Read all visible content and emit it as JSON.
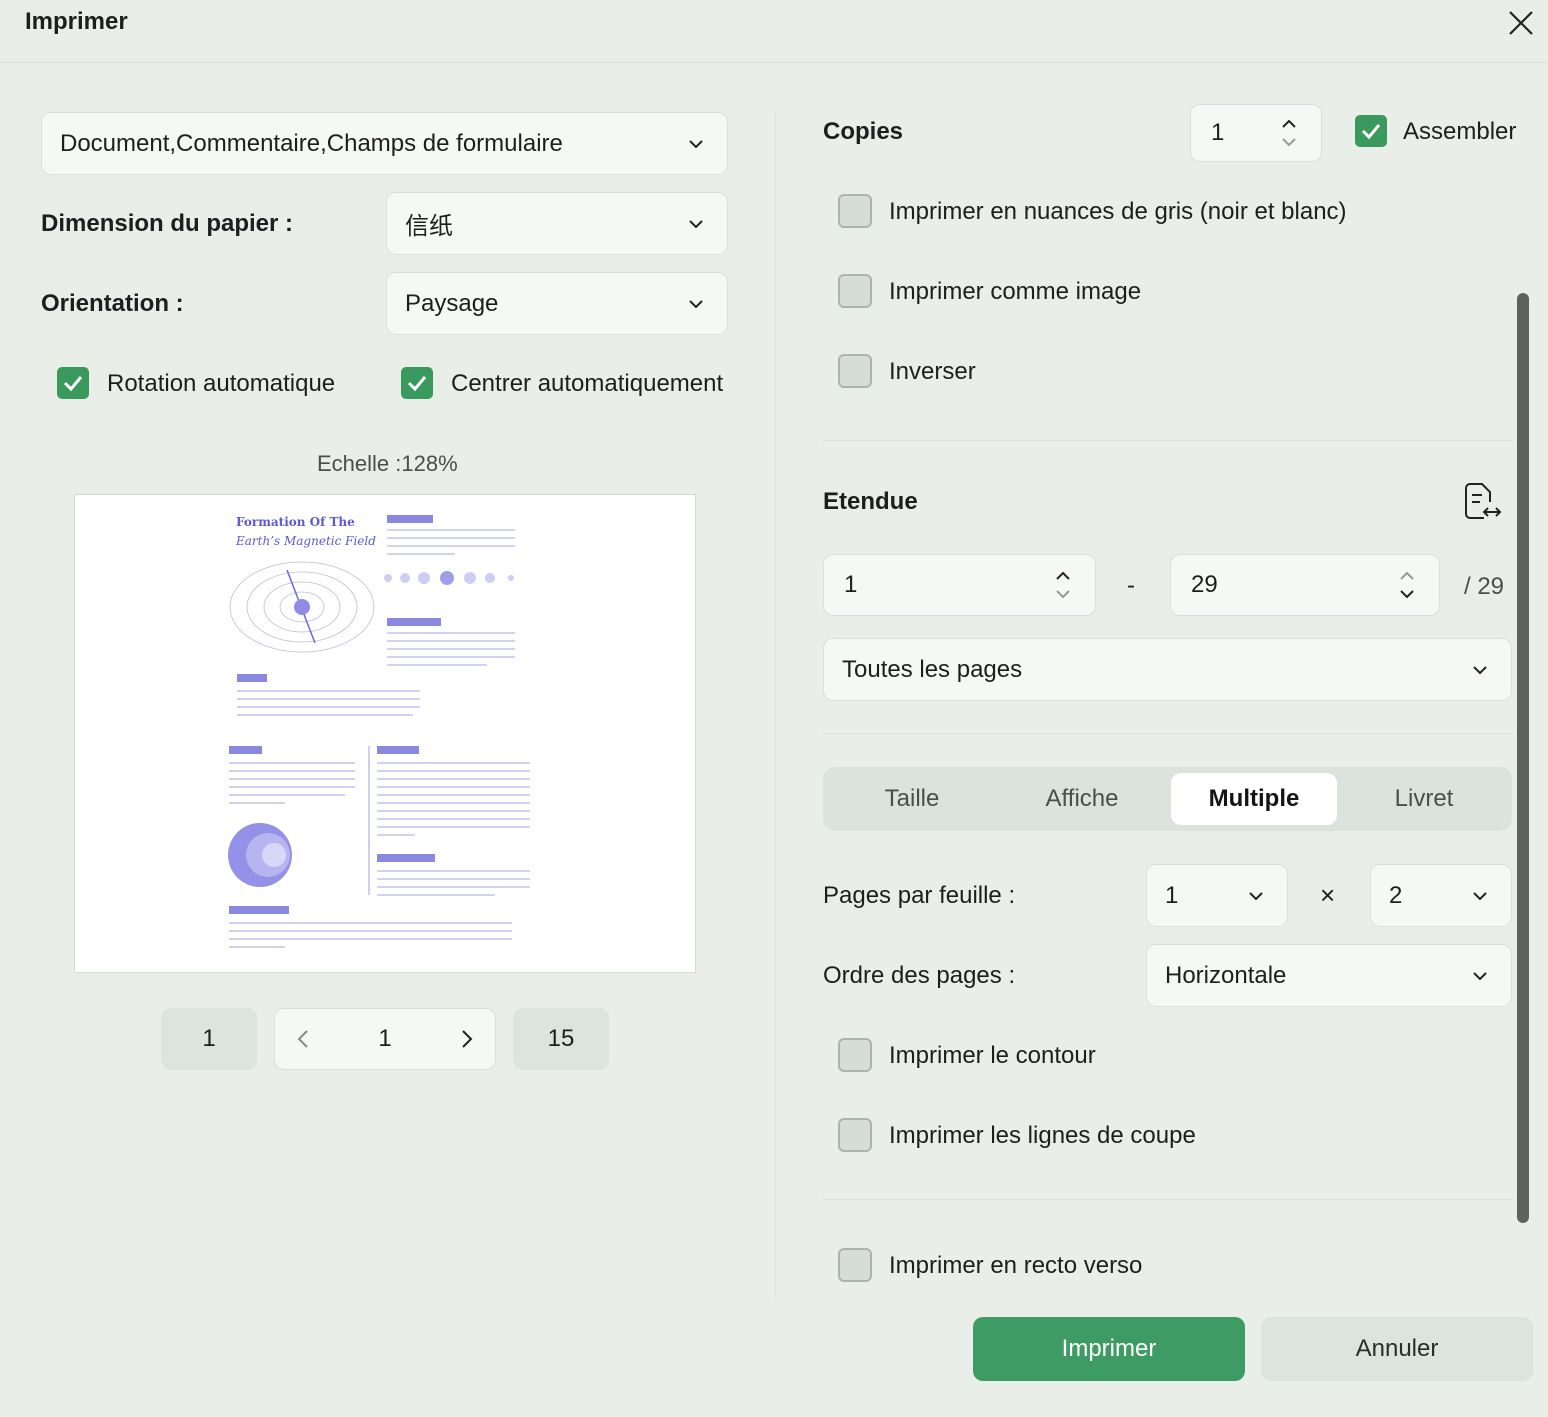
{
  "dialog": {
    "title": "Imprimer"
  },
  "left": {
    "content_select": "Document,Commentaire,Champs de formulaire",
    "paper_label": "Dimension du papier :",
    "paper_value": "信纸",
    "orientation_label": "Orientation :",
    "orientation_value": "Paysage",
    "auto_rotate": "Rotation automatique",
    "auto_center": "Centrer automatiquement",
    "scale": "Echelle :128%",
    "pager": {
      "first": "1",
      "current": "1",
      "last": "15"
    }
  },
  "preview": {
    "title_line1": "Formation Of The",
    "title_line2": "Earth’s Magnetic Field"
  },
  "right": {
    "copies_label": "Copies",
    "copies_value": "1",
    "collate": "Assembler",
    "grayscale": "Imprimer en nuances de gris (noir et blanc)",
    "as_image": "Imprimer comme image",
    "reverse": "Inverser",
    "range_label": "Etendue",
    "range_from": "1",
    "range_dash": "-",
    "range_to": "29",
    "range_total": "/ 29",
    "pages_select": "Toutes les pages",
    "tabs": [
      "Taille",
      "Affiche",
      "Multiple",
      "Livret"
    ],
    "active_tab": "Multiple",
    "pages_per_sheet_label": "Pages par feuille :",
    "pps_cols": "1",
    "pps_x": "×",
    "pps_rows": "2",
    "page_order_label": "Ordre des pages :",
    "page_order_value": "Horizontale",
    "print_border": "Imprimer le contour",
    "print_cut_lines": "Imprimer les lignes de coupe",
    "duplex": "Imprimer en recto verso"
  },
  "buttons": {
    "print": "Imprimer",
    "cancel": "Annuler"
  },
  "colors": {
    "accent": "#3f9b64",
    "checkbox": "#3a9a5e",
    "preview_text": "#5b58d6"
  }
}
